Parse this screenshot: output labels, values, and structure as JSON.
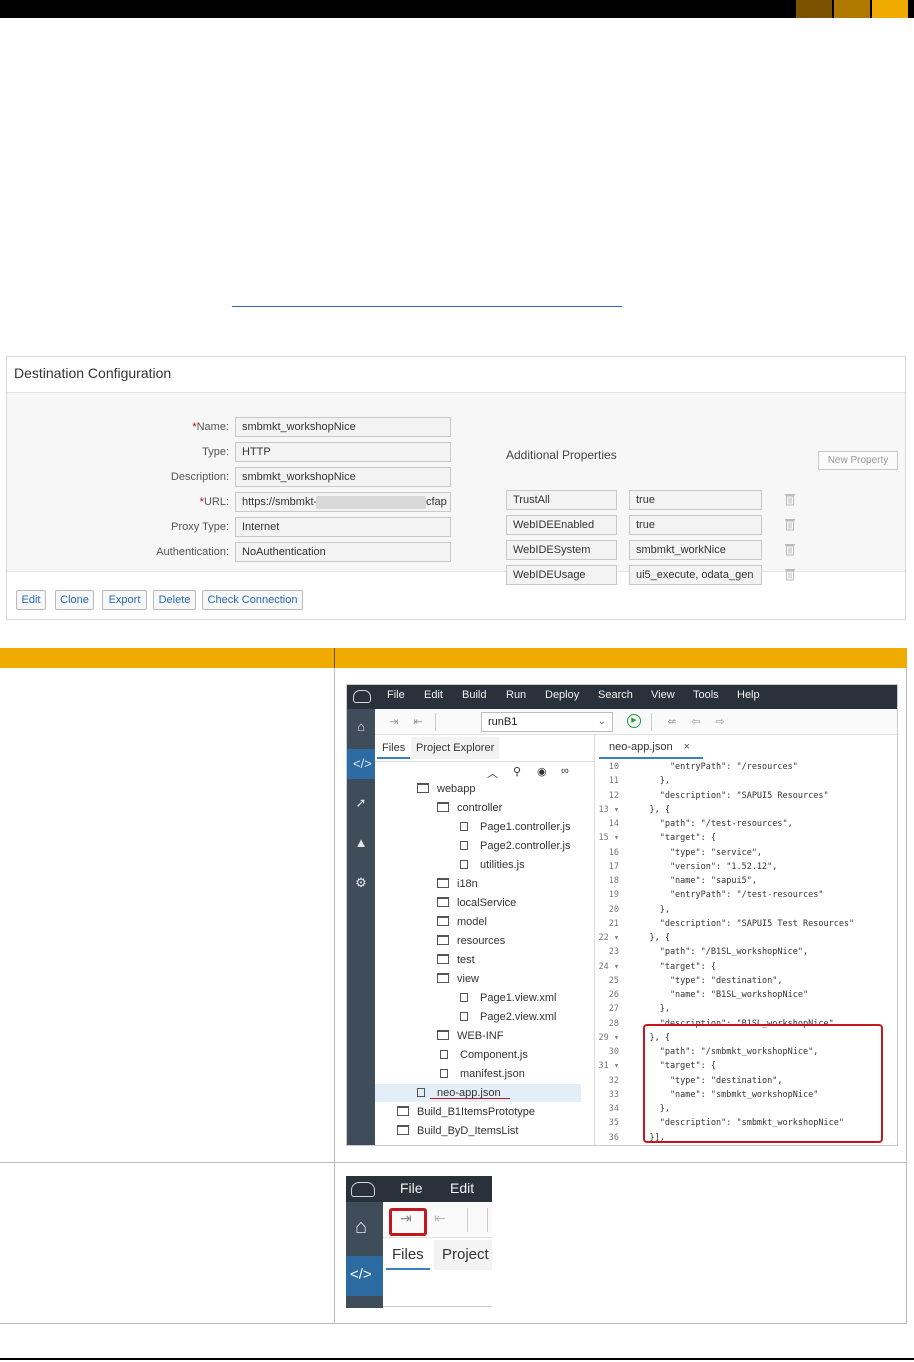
{
  "colors": {
    "accent": "#f0ab00",
    "highlight": "#c5181e",
    "ide_dark": "#29313a",
    "ide_side": "#3f4d5a"
  },
  "destination": {
    "title": "Destination Configuration",
    "fields": [
      {
        "label": "Name:",
        "required": true,
        "value": "smbmkt_workshopNice"
      },
      {
        "label": "Type:",
        "required": false,
        "value": "HTTP"
      },
      {
        "label": "Description:",
        "required": false,
        "value": "smbmkt_workshopNice"
      },
      {
        "label": "URL:",
        "required": true,
        "value": "https://smbmkt-",
        "value_suffix": "cfap"
      },
      {
        "label": "Proxy Type:",
        "required": false,
        "value": "Internet"
      },
      {
        "label": "Authentication:",
        "required": false,
        "value": "NoAuthentication"
      }
    ],
    "additional_properties_label": "Additional Properties",
    "new_property_label": "New Property",
    "properties": [
      {
        "key": "TrustAll",
        "value": "true"
      },
      {
        "key": "WebIDEEnabled",
        "value": "true"
      },
      {
        "key": "WebIDESystem",
        "value": "smbmkt_workNice"
      },
      {
        "key": "WebIDEUsage",
        "value": "ui5_execute, odata_gen"
      }
    ],
    "buttons": [
      "Edit",
      "Clone",
      "Export",
      "Delete",
      "Check Connection"
    ]
  },
  "ide1": {
    "menu": [
      "File",
      "Edit",
      "Build",
      "Run",
      "Deploy",
      "Search",
      "View",
      "Tools",
      "Help"
    ],
    "run_config": "runB1",
    "file_tabs": [
      "Files",
      "Project Explorer"
    ],
    "tree": [
      {
        "name": "webapp",
        "type": "folder",
        "indent": 0
      },
      {
        "name": "controller",
        "type": "folder",
        "indent": 1
      },
      {
        "name": "Page1.controller.js",
        "type": "file",
        "indent": 2
      },
      {
        "name": "Page2.controller.js",
        "type": "file",
        "indent": 2
      },
      {
        "name": "utilities.js",
        "type": "file",
        "indent": 2
      },
      {
        "name": "i18n",
        "type": "folder",
        "indent": 1
      },
      {
        "name": "localService",
        "type": "folder",
        "indent": 1
      },
      {
        "name": "model",
        "type": "folder",
        "indent": 1
      },
      {
        "name": "resources",
        "type": "folder",
        "indent": 1
      },
      {
        "name": "test",
        "type": "folder",
        "indent": 1
      },
      {
        "name": "view",
        "type": "folder",
        "indent": 1
      },
      {
        "name": "Page1.view.xml",
        "type": "file",
        "indent": 2
      },
      {
        "name": "Page2.view.xml",
        "type": "file",
        "indent": 2
      },
      {
        "name": "WEB-INF",
        "type": "folder",
        "indent": 1
      },
      {
        "name": "Component.js",
        "type": "file",
        "indent": 1
      },
      {
        "name": "manifest.json",
        "type": "file",
        "indent": 1
      },
      {
        "name": "neo-app.json",
        "type": "file",
        "indent": 0,
        "selected": true
      },
      {
        "name": "Build_B1ItemsPrototype",
        "type": "folder",
        "indent": -1
      },
      {
        "name": "Build_ByD_ItemsList",
        "type": "folder",
        "indent": -1
      }
    ],
    "editor_tab": "neo-app.json",
    "code": [
      {
        "n": "10",
        "t": "        \"entryPath\": \"/resources\""
      },
      {
        "n": "11",
        "t": "      },"
      },
      {
        "n": "12",
        "t": "      \"description\": \"SAPUI5 Resources\""
      },
      {
        "n": "13 ▾",
        "t": "    }, {"
      },
      {
        "n": "14",
        "t": "      \"path\": \"/test-resources\","
      },
      {
        "n": "15 ▾",
        "t": "      \"target\": {"
      },
      {
        "n": "16",
        "t": "        \"type\": \"service\","
      },
      {
        "n": "17",
        "t": "        \"version\": \"1.52.12\","
      },
      {
        "n": "18",
        "t": "        \"name\": \"sapui5\","
      },
      {
        "n": "19",
        "t": "        \"entryPath\": \"/test-resources\""
      },
      {
        "n": "20",
        "t": "      },"
      },
      {
        "n": "21",
        "t": "      \"description\": \"SAPUI5 Test Resources\""
      },
      {
        "n": "22 ▾",
        "t": "    }, {"
      },
      {
        "n": "23",
        "t": "      \"path\": \"/B1SL_workshopNice\","
      },
      {
        "n": "24 ▾",
        "t": "      \"target\": {"
      },
      {
        "n": "25",
        "t": "        \"type\": \"destination\","
      },
      {
        "n": "26",
        "t": "        \"name\": \"B1SL_workshopNice\""
      },
      {
        "n": "27",
        "t": "      },"
      },
      {
        "n": "28",
        "t": "      \"description\": \"B1SL_workshopNice\""
      },
      {
        "n": "29 ▾",
        "t": "    }, {"
      },
      {
        "n": "30",
        "t": "      \"path\": \"/smbmkt_workshopNice\","
      },
      {
        "n": "31 ▾",
        "t": "      \"target\": {"
      },
      {
        "n": "32",
        "t": "        \"type\": \"destination\","
      },
      {
        "n": "33",
        "t": "        \"name\": \"smbmkt_workshopNice\""
      },
      {
        "n": "34",
        "t": "      },"
      },
      {
        "n": "35",
        "t": "      \"description\": \"smbmkt_workshopNice\""
      },
      {
        "n": "36",
        "t": "    }],"
      }
    ]
  },
  "ide2": {
    "menu": [
      "File",
      "Edit"
    ],
    "tabs": [
      "Files",
      "Project"
    ]
  }
}
